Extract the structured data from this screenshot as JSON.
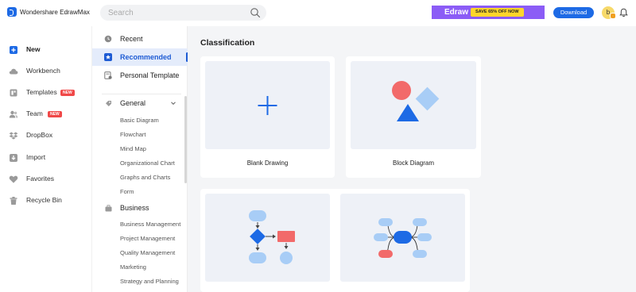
{
  "app": {
    "name": "Wondershare EdrawMax"
  },
  "search": {
    "placeholder": "Search"
  },
  "promo": {
    "brand": "Edraw",
    "offer": "SAVE 65% OFF NOW"
  },
  "header": {
    "download_label": "Download",
    "avatar_initial": "b"
  },
  "sidebar": {
    "items": [
      {
        "label": "New",
        "icon": "plus-square-icon",
        "active": true
      },
      {
        "label": "Workbench",
        "icon": "cloud-icon"
      },
      {
        "label": "Templates",
        "icon": "templates-icon",
        "badge": "NEW"
      },
      {
        "label": "Team",
        "icon": "team-icon",
        "badge": "NEW"
      },
      {
        "label": "DropBox",
        "icon": "dropbox-icon"
      },
      {
        "label": "Import",
        "icon": "import-icon"
      },
      {
        "label": "Favorites",
        "icon": "heart-icon"
      },
      {
        "label": "Recycle Bin",
        "icon": "trash-icon"
      }
    ]
  },
  "categories": {
    "top": [
      {
        "label": "Recent",
        "icon": "clock-icon"
      },
      {
        "label": "Recommended",
        "icon": "star-icon",
        "selected": true
      },
      {
        "label": "Personal Template",
        "icon": "personal-template-icon"
      }
    ],
    "groups": [
      {
        "label": "General",
        "icon": "general-icon",
        "items": [
          "Basic Diagram",
          "Flowchart",
          "Mind Map",
          "Organizational Chart",
          "Graphs and Charts",
          "Form"
        ]
      },
      {
        "label": "Business",
        "icon": "business-icon",
        "items": [
          "Business Management",
          "Project Management",
          "Quality Management",
          "Marketing",
          "Strategy and Planning"
        ]
      }
    ]
  },
  "main": {
    "title": "Classification",
    "cards": [
      {
        "label": "Blank Drawing"
      },
      {
        "label": "Block Diagram"
      },
      {
        "label": ""
      },
      {
        "label": ""
      }
    ]
  },
  "colors": {
    "accent": "#1D6AE5",
    "promo": "#8B5CF6",
    "badge": "#F04848",
    "shape_red": "#F26A6A",
    "shape_blue": "#1D6AE5",
    "shape_lightblue": "#A8CDF6"
  }
}
